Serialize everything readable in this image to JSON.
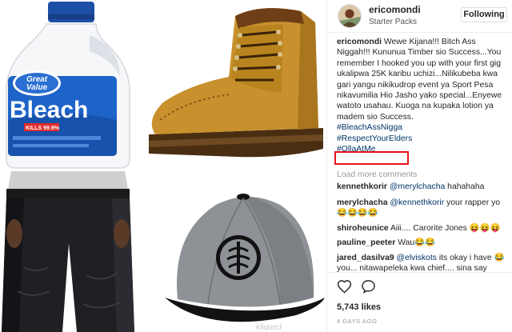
{
  "header": {
    "username": "ericomondi",
    "location": "Starter Packs",
    "follow_label": "Following"
  },
  "caption": {
    "username": "ericomondi",
    "text": "Wewe Kijana!!! Bitch Ass Niggah!!! Kununua Timber sio Success...You remember I hooked you up with your first gig ukalipwa 25K karibu uchizi...Nilikubeba kwa gari yangu nikikudrop event ya Sport Pesa nikavumilia Hio Jasho yako special...Enyewe watoto usahau. Kuoga na kupaka lotion ya madem sio Success.",
    "hashtags": [
      "#BleachAssNigga",
      "#RespectYourElders",
      "#OllaAtMe"
    ]
  },
  "load_more_label": "Load more comments",
  "comments": [
    {
      "username": "kennethkorir",
      "mention": "@merylchacha",
      "text": "hahahaha"
    },
    {
      "username": "merylchacha",
      "mention": "@kennethkorir",
      "text": "your rapper yo 😂😂😂😂"
    },
    {
      "username": "shiroheunice",
      "mention": "",
      "text": "Aiii.... Carorite Jones 😝😝😝"
    },
    {
      "username": "pauline_peeter",
      "mention": "",
      "text": "Wau😂😂"
    },
    {
      "username": "jared_dasilva9",
      "mention": "@elviskots",
      "text": "its okay i have 😂 you... nitawapeleka kwa chief.... sina say"
    }
  ],
  "likes": "5,743 likes",
  "timestamp": "4 DAYS AGO",
  "collage": {
    "bleach_brand_top": "Great",
    "bleach_brand_bottom": "Value",
    "bleach_label": "Bleach",
    "bleach_small": "KILLS 99.9%",
    "watermark": "kliqued"
  },
  "icons": {
    "heart": "heart-icon",
    "comment": "comment-icon",
    "avatar": "avatar"
  },
  "colors": {
    "link": "#003569",
    "highlight": "#e8121d",
    "boot": "#c8912e"
  }
}
